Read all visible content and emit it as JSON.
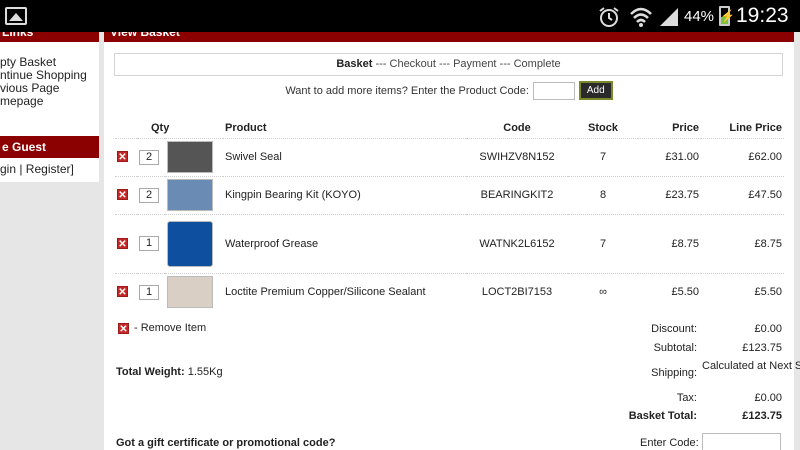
{
  "status_bar": {
    "battery": "44%",
    "time": "19:23",
    "icons": [
      "gallery-icon",
      "alarm-icon",
      "wifi-icon",
      "signal-icon",
      "battery-charging-icon"
    ]
  },
  "sidebar": {
    "links_heading": "Links",
    "links": [
      "pty Basket",
      "ntinue Shopping",
      "vious Page",
      "mepage"
    ],
    "guest_heading": "e Guest",
    "guest_links": "gin | Register]"
  },
  "main": {
    "heading": "View Basket",
    "steps": {
      "active": "Basket",
      "rest": " --- Checkout --- Payment --- Complete"
    },
    "add_prompt": "Want to add more items? Enter the Product Code:",
    "add_button": "Add",
    "columns": [
      "Qty",
      "Product",
      "Code",
      "Stock",
      "Price",
      "Line Price"
    ],
    "items": [
      {
        "qty": "2",
        "product": "Swivel Seal",
        "code": "SWIHZV8N152",
        "stock": "7",
        "price": "£31.00",
        "line": "£62.00"
      },
      {
        "qty": "2",
        "product": "Kingpin Bearing Kit (KOYO)",
        "code": "BEARINGKIT2",
        "stock": "8",
        "price": "£23.75",
        "line": "£47.50"
      },
      {
        "qty": "1",
        "product": "Waterproof Grease",
        "code": "WATNK2L6152",
        "stock": "7",
        "price": "£8.75",
        "line": "£8.75"
      },
      {
        "qty": "1",
        "product": "Loctite Premium Copper/Silicone Sealant",
        "code": "LOCT2BI7153",
        "stock": "∞",
        "price": "£5.50",
        "line": "£5.50"
      }
    ],
    "remove_legend": "- Remove Item",
    "weight_label": "Total Weight:",
    "weight_value": "1.55Kg",
    "totals": {
      "discount_label": "Discount:",
      "discount": "£0.00",
      "subtotal_label": "Subtotal:",
      "subtotal": "£123.75",
      "shipping_label": "Shipping:",
      "shipping": "Calculated at Next Step",
      "tax_label": "Tax:",
      "tax": "£0.00",
      "total_label": "Basket Total:",
      "total": "£123.75"
    },
    "gift_prompt": "Got a gift certificate or promotional code?",
    "enter_code_label": "Enter Code:"
  },
  "colors": {
    "header_red": "#8b0000",
    "remove_red": "#c62828"
  }
}
